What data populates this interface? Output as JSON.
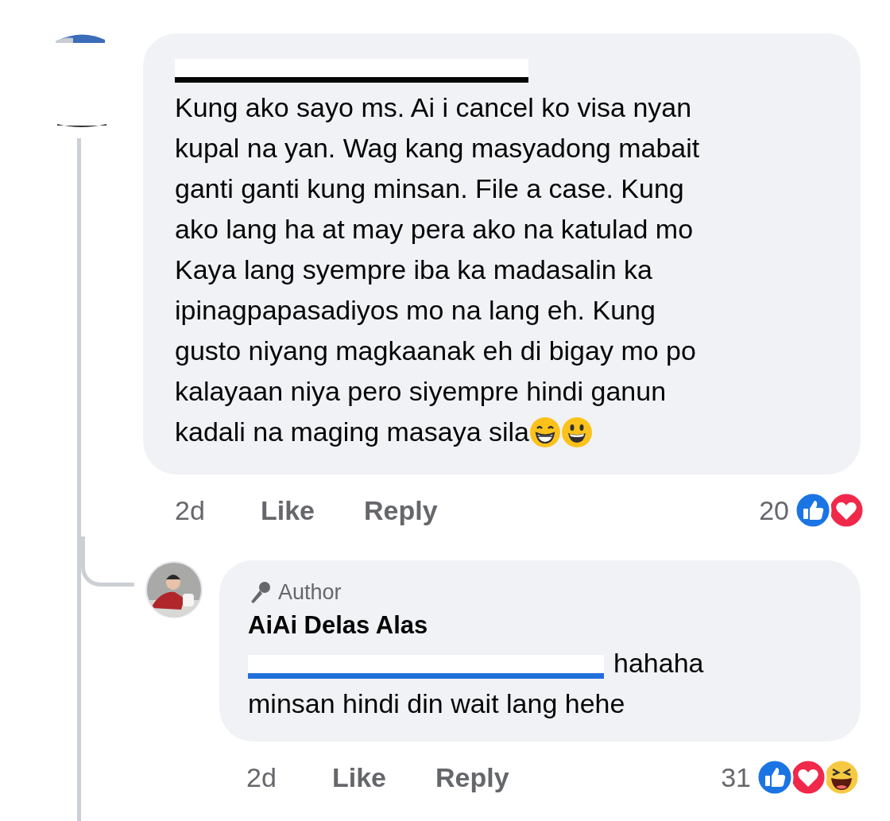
{
  "comment": {
    "name_redacted": true,
    "lines": [
      "Kung ako sayo ms. Ai i cancel ko visa nyan",
      "kupal na yan. Wag kang masyadong mabait",
      "ganti ganti kung minsan. File a case. Kung",
      "ako lang ha at may pera ako na katulad mo",
      "Kaya lang syempre iba ka madasalin ka",
      "ipinagpapasadiyos mo na lang eh. Kung",
      "gusto niyang magkaanak eh di bigay mo po",
      "kalayaan niya pero siyempre hindi ganun",
      "kadali na maging masaya sila"
    ],
    "time": "2d",
    "like": "Like",
    "reply": "Reply",
    "count": "20",
    "reactions": [
      {
        "kind": "like"
      },
      {
        "kind": "love"
      }
    ]
  },
  "reply": {
    "badge": "Author",
    "name": "AiAi Delas Alas",
    "mention_redacted": true,
    "lines": [
      "hahaha",
      "minsan hindi din wait lang hehe"
    ],
    "time": "2d",
    "like": "Like",
    "reply": "Reply",
    "count": "31",
    "reactions": [
      {
        "kind": "like"
      },
      {
        "kind": "love"
      },
      {
        "kind": "haha"
      }
    ]
  }
}
